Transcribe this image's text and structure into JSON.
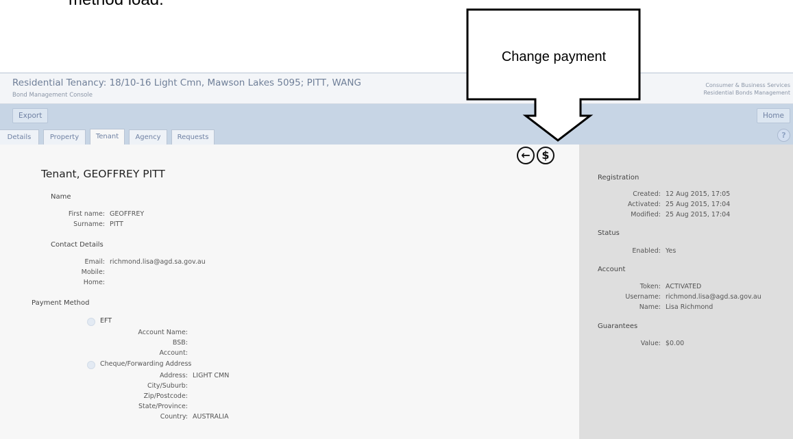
{
  "caption": "method load.",
  "callout": {
    "text": "Change payment"
  },
  "header": {
    "title": "Residential Tenancy: 18/10-16 Light Cmn, Mawson Lakes 5095; PITT, WANG",
    "subtitle": "Bond Management Console",
    "right_line1": "Consumer & Business Services",
    "right_line2": "Residential Bonds Management"
  },
  "toolbar": {
    "export_label": "Export",
    "home_label": "Home"
  },
  "tabs": [
    {
      "label": "Details"
    },
    {
      "label": "Property"
    },
    {
      "label": "Tenant"
    },
    {
      "label": "Agency"
    },
    {
      "label": "Requests"
    }
  ],
  "icons": {
    "back": "back-arrow-icon",
    "payment": "dollar-icon"
  },
  "tenant": {
    "title": "Tenant, GEOFFREY PITT",
    "name_section": "Name",
    "first_name_label": "First name:",
    "first_name": "GEOFFREY",
    "surname_label": "Surname:",
    "surname": "PITT",
    "contact_section": "Contact Details",
    "email_label": "Email:",
    "email": "richmond.lisa@agd.sa.gov.au",
    "mobile_label": "Mobile:",
    "home_label": "Home:"
  },
  "payment": {
    "section": "Payment Method",
    "eft_label": "EFT",
    "account_name_label": "Account Name:",
    "bsb_label": "BSB:",
    "account_label": "Account:",
    "cheque_label": "Cheque/Forwarding Address",
    "address_label": "Address:",
    "address": "LIGHT CMN",
    "city_label": "City/Suburb:",
    "zip_label": "Zip/Postcode:",
    "state_label": "State/Province:",
    "country_label": "Country:",
    "country": "AUSTRALIA"
  },
  "side": {
    "registration": "Registration",
    "created_label": "Created:",
    "created": "12 Aug 2015, 17:05",
    "activated_label": "Activated:",
    "activated": "25 Aug 2015, 17:04",
    "modified_label": "Modified:",
    "modified": "25 Aug 2015, 17:04",
    "status": "Status",
    "enabled_label": "Enabled:",
    "enabled": "Yes",
    "account": "Account",
    "token_label": "Token:",
    "token": "ACTIVATED",
    "username_label": "Username:",
    "username": "richmond.lisa@agd.sa.gov.au",
    "name_label": "Name:",
    "name": "Lisa Richmond",
    "guarantees": "Guarantees",
    "value_label": "Value:",
    "value": "$0.00"
  }
}
